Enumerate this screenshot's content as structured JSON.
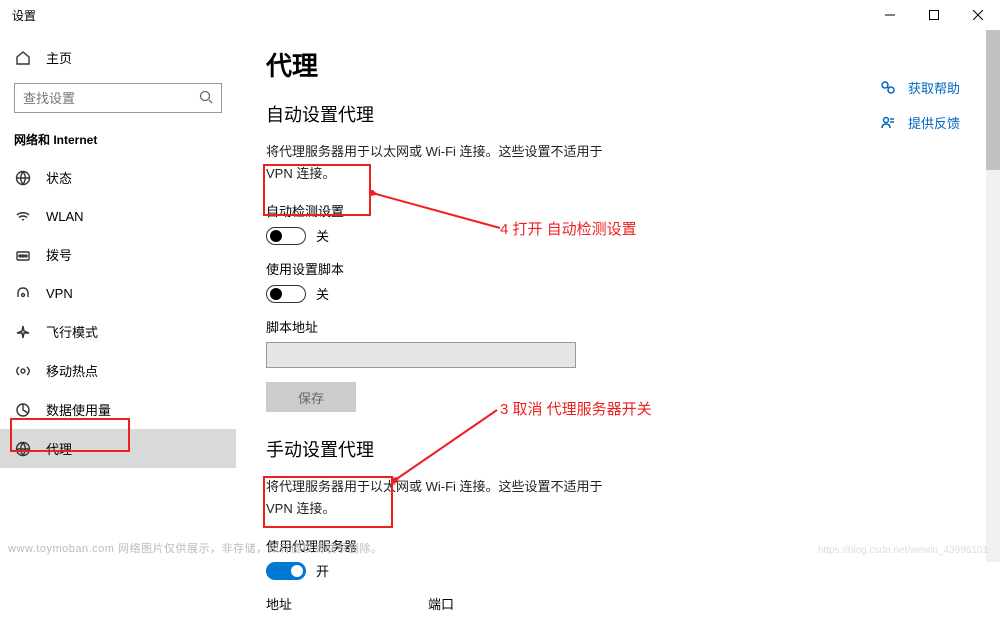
{
  "window": {
    "title": "设置"
  },
  "sidebar": {
    "home_label": "主页",
    "search_placeholder": "查找设置",
    "category": "网络和 Internet",
    "items": [
      {
        "label": "状态"
      },
      {
        "label": "WLAN"
      },
      {
        "label": "拨号"
      },
      {
        "label": "VPN"
      },
      {
        "label": "飞行模式"
      },
      {
        "label": "移动热点"
      },
      {
        "label": "数据使用量"
      },
      {
        "label": "代理",
        "active": true
      }
    ]
  },
  "content": {
    "page_title": "代理",
    "auto_section": {
      "heading": "自动设置代理",
      "description": "将代理服务器用于以太网或 Wi-Fi 连接。这些设置不适用于 VPN 连接。",
      "auto_detect_label": "自动检测设置",
      "auto_detect_state": "关",
      "use_script_label": "使用设置脚本",
      "use_script_state": "关",
      "script_address_label": "脚本地址",
      "save_label": "保存"
    },
    "manual_section": {
      "heading": "手动设置代理",
      "description": "将代理服务器用于以太网或 Wi-Fi 连接。这些设置不适用于 VPN 连接。",
      "use_proxy_label": "使用代理服务器",
      "use_proxy_state": "开",
      "address_label": "地址",
      "port_label": "端口"
    }
  },
  "help": {
    "get_help": "获取帮助",
    "feedback": "提供反馈"
  },
  "annotations": {
    "step4": "4 打开 自动检测设置",
    "step3": "3 取消 代理服务器开关"
  },
  "watermarks": {
    "left": "www.toymoban.com  网络图片仅供展示，非存储，如有侵权请联系删除。",
    "right": "https://blog.csdn.net/weixin_43996101"
  }
}
